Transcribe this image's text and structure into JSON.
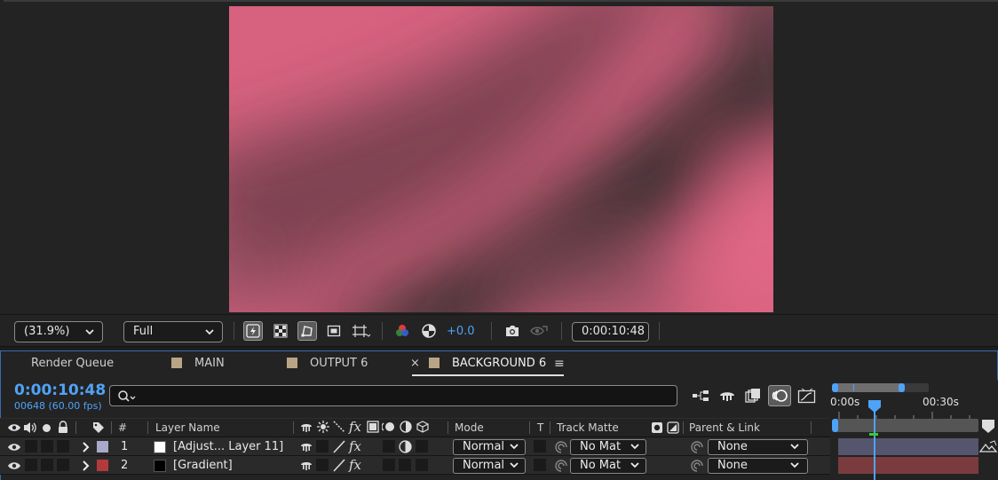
{
  "viewer": {
    "zoom": "(31.9%)",
    "resolution": "Full",
    "exposure": "+0.0",
    "timecode": "0:00:10:48"
  },
  "tabs": [
    {
      "label": "Render Queue"
    },
    {
      "label": "MAIN",
      "swatch": "#b9a585"
    },
    {
      "label": "OUTPUT 6",
      "swatch": "#b9a585"
    },
    {
      "label": "BACKGROUND 6",
      "swatch": "#b9a585",
      "active": true,
      "close": "×",
      "menu": "≡"
    }
  ],
  "timeline": {
    "current_time": "0:00:10:48",
    "frame_info": "00648 (60.00 fps)",
    "search_placeholder": "",
    "ruler": {
      "start": "0:00s",
      "mark": "00:30s"
    }
  },
  "columns": {
    "number": "#",
    "layer_name": "Layer Name",
    "mode": "Mode",
    "t": "T",
    "track_matte": "Track Matte",
    "parent_link": "Parent & Link"
  },
  "layers": [
    {
      "index": "1",
      "label_color": "#a9a9c9",
      "thumb_color": "#ffffff",
      "name": "[Adjust... Layer 11]",
      "mode": "Normal",
      "matte": "No Mat",
      "parent": "None",
      "bar_color": "#55556e"
    },
    {
      "index": "2",
      "label_color": "#b33a3a",
      "thumb_color": "#000000",
      "name": "[Gradient]",
      "mode": "Normal",
      "matte": "No Mat",
      "parent": "None",
      "bar_color": "#7a3b3f"
    }
  ]
}
